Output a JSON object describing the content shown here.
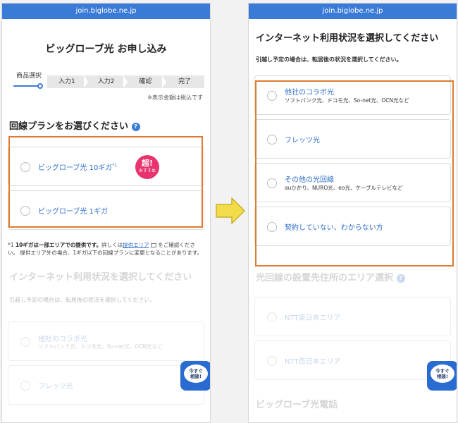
{
  "url": "join.biglobe.ne.jp",
  "left": {
    "title": "ビッグローブ光 お申し込み",
    "steps": [
      "商品選択",
      "入力1",
      "入力2",
      "確認",
      "完了"
    ],
    "tax_note": "※表示金額は税込です",
    "plan_title": "回線プランをお選びください",
    "help": "?",
    "plans": [
      {
        "label": "ビッグローブ光 10ギガ",
        "sup": "*1"
      },
      {
        "label": "ビッグローブ光 1ギガ"
      }
    ],
    "badge": {
      "big": "超!",
      "small": "おすすめ"
    },
    "footnote": {
      "mark": "*1",
      "bold": "10ギガは一部エリアでの提供です。",
      "pre": "詳しくは",
      "link": "提供エリア",
      "post": "をご確認ください。 提供エリア外の場合、1ギガ以下の回線プランに変更となることがあります。"
    },
    "usage_title": "インターネット利用状況を選択してください",
    "usage_note": "引越し予定の場合は、転居後の状況を選択してください。",
    "usage_options": [
      {
        "label": "他社のコラボ光",
        "sub": "ソフトバンク光、ドコモ光、So-net光、OCN光など"
      },
      {
        "label": "フレッツ光"
      }
    ]
  },
  "right": {
    "usage_title": "インターネット利用状況を選択してください",
    "usage_note": "引越し予定の場合は、転居後の状況を選択してください。",
    "usage_options": [
      {
        "label": "他社のコラボ光",
        "sub": "ソフトバンク光、ドコモ光、So-net光、OCN光など"
      },
      {
        "label": "フレッツ光"
      },
      {
        "label": "その他の光回線",
        "sub": "auひかり、NURO光、eo光、ケーブルテレビなど"
      },
      {
        "label": "契約していない、わからない方"
      }
    ],
    "area_title": "光回線の設置先住所のエリア選択",
    "help": "?",
    "area_options": [
      {
        "label": "NTT東日本エリア"
      },
      {
        "label": "NTT西日本エリア"
      }
    ],
    "next_title": "ビッグローブ光電話"
  },
  "chat": {
    "line1": "今すぐ",
    "line2": "相談!"
  },
  "colors": {
    "accent": "#3b7bd8",
    "highlight": "#e07a30",
    "badge": "#e8336d",
    "arrow": "#f2dc4a"
  }
}
